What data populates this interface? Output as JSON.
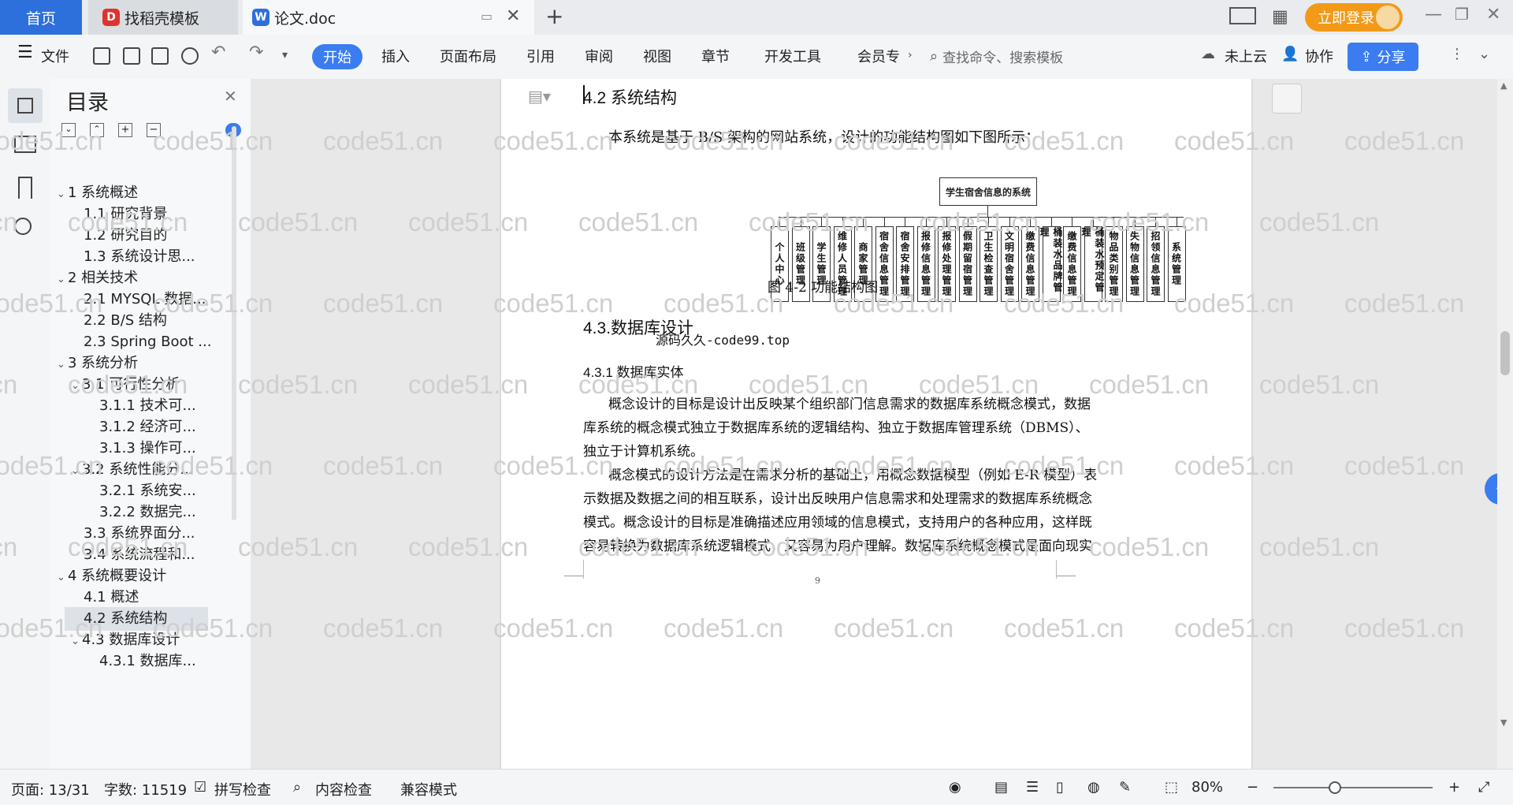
{
  "tabs": {
    "home": "首页",
    "template": "找稻壳模板",
    "doc": "论文.doc",
    "login": "立即登录"
  },
  "toolbar": {
    "file": "文件",
    "start": "开始",
    "insert": "插入",
    "layout": "页面布局",
    "reference": "引用",
    "review": "审阅",
    "view": "视图",
    "chapter": "章节",
    "devtools": "开发工具",
    "member": "会员专",
    "search_placeholder": "查找命令、搜索模板",
    "cloud": "未上云",
    "collab": "协作",
    "share": "分享"
  },
  "toc": {
    "title": "目录",
    "items": [
      {
        "label": "1 系统概述",
        "level": 1,
        "caret": "v"
      },
      {
        "label": "1.1 研究背景",
        "level": 2,
        "caret": ""
      },
      {
        "label": "1.2 研究目的",
        "level": 2,
        "caret": ""
      },
      {
        "label": "1.3 系统设计思...",
        "level": 2,
        "caret": ""
      },
      {
        "label": "2 相关技术",
        "level": 1,
        "caret": "v"
      },
      {
        "label": "2.1 MYSQL 数据...",
        "level": 2,
        "caret": ""
      },
      {
        "label": "2.2 B/S 结构",
        "level": 2,
        "caret": ""
      },
      {
        "label": "2.3 Spring Boot ...",
        "level": 2,
        "caret": ""
      },
      {
        "label": "3 系统分析",
        "level": 1,
        "caret": "v"
      },
      {
        "label": "3.1 可行性分析",
        "level": 2,
        "caret": "v"
      },
      {
        "label": "3.1.1 技术可...",
        "level": 3,
        "caret": ""
      },
      {
        "label": "3.1.2 经济可...",
        "level": 3,
        "caret": ""
      },
      {
        "label": "3.1.3 操作可...",
        "level": 3,
        "caret": ""
      },
      {
        "label": "3.2 系统性能分...",
        "level": 2,
        "caret": "v"
      },
      {
        "label": "3.2.1 系统安...",
        "level": 3,
        "caret": ""
      },
      {
        "label": "3.2.2 数据完...",
        "level": 3,
        "caret": ""
      },
      {
        "label": "3.3 系统界面分...",
        "level": 2,
        "caret": ""
      },
      {
        "label": "3.4 系统流程和...",
        "level": 2,
        "caret": ""
      },
      {
        "label": "4 系统概要设计",
        "level": 1,
        "caret": "v"
      },
      {
        "label": "4.1 概述",
        "level": 2,
        "caret": ""
      },
      {
        "label": "4.2 系统结构",
        "level": 2,
        "caret": "",
        "selected": true
      },
      {
        "label": "4.3 数据库设计",
        "level": 2,
        "caret": "v"
      },
      {
        "label": "4.3.1 数据库...",
        "level": 3,
        "caret": ""
      }
    ]
  },
  "document": {
    "heading_42": "4.2 系统结构",
    "intro": "本系统是基于 B/S 架构的网站系统，设计的功能结构图如下图所示：",
    "diagram_root": "学生宿舍信息的系统",
    "diagram_nodes": [
      "个人中心",
      "班级管理",
      "学生管理",
      "维修人员管理",
      "商家管理",
      "宿舍信息管理",
      "宿舍安排管理",
      "报修信息管理",
      "报修处理管理",
      "假期留宿管理",
      "卫生检查管理",
      "文明宿舍管理",
      "缴费信息管理",
      "桶装水品牌管理",
      "缴费信息管理",
      "桶装水预定管理",
      "物品类别管理",
      "失物信息管理",
      "招领信息管理",
      "系统管理"
    ],
    "figure_caption": "图 4-2 功能结构图",
    "heading_43": "4.3.数据库设计",
    "source_note": "源码久久-code99.top",
    "heading_431": "4.3.1 数据库实体",
    "lines": [
      "概念设计的目标是设计出反映某个组织部门信息需求的数据库系统概念模式，数据",
      "库系统的概念模式独立于数据库系统的逻辑结构、独立于数据库管理系统（DBMS）、",
      "独立于计算机系统。",
      "概念模式的设计方法是在需求分析的基础上，用概念数据模型（例如 E-R 模型）表",
      "示数据及数据之间的相互联系，设计出反映用户信息需求和处理需求的数据库系统概念",
      "模式。概念设计的目标是准确描述应用领域的信息模式，支持用户的各种应用，这样既",
      "容易转换为数据库系统逻辑模式，又容易为用户理解。数据库系统概念模式是面向现实"
    ],
    "page_number": "9",
    "watermark": "code51.cn"
  },
  "status": {
    "page": "页面: 13/31",
    "words": "字数: 11519",
    "spell": "拼写检查",
    "content": "内容检查",
    "compat": "兼容模式",
    "zoom": "80%"
  }
}
